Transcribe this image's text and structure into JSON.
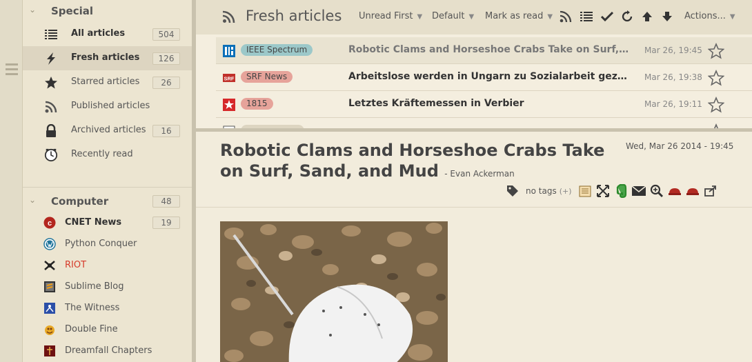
{
  "sidebar": {
    "special": {
      "title": "Special",
      "items": [
        {
          "label": "All articles",
          "count": "504",
          "icon": "list-icon"
        },
        {
          "label": "Fresh articles",
          "count": "126",
          "icon": "lightning-icon"
        },
        {
          "label": "Starred articles",
          "count": "26",
          "icon": "star-icon"
        },
        {
          "label": "Published articles",
          "count": "",
          "icon": "rss-icon"
        },
        {
          "label": "Archived articles",
          "count": "16",
          "icon": "lock-icon"
        },
        {
          "label": "Recently read",
          "count": "",
          "icon": "clock-icon"
        }
      ]
    },
    "computer": {
      "title": "Computer",
      "count": "48",
      "feeds": [
        {
          "label": "CNET News",
          "count": "19",
          "icon": "cnet-icon"
        },
        {
          "label": "Python Conquer",
          "count": "",
          "icon": "wordpress-icon"
        },
        {
          "label": "RIOT",
          "count": "",
          "icon": "riot-icon"
        },
        {
          "label": "Sublime Blog",
          "count": "",
          "icon": "sublime-icon"
        },
        {
          "label": "The Witness",
          "count": "",
          "icon": "witness-icon"
        },
        {
          "label": "Double Fine",
          "count": "",
          "icon": "doublefine-icon"
        },
        {
          "label": "Dreamfall Chapters",
          "count": "",
          "icon": "dreamfall-icon"
        }
      ]
    }
  },
  "toolbar": {
    "feed_title": "Fresh articles",
    "order": "Unread First",
    "view": "Default",
    "mark": "Mark as read",
    "actions": "Actions..."
  },
  "headlines": [
    {
      "tag": "IEEE Spectrum",
      "tag_color": "#9cc8c9",
      "title": "Robotic Clams and Horseshoe Crabs Take on Surf, Sand, and Mud",
      "date": "Mar 26, 19:45"
    },
    {
      "tag": "SRF News",
      "tag_color": "#e6a39a",
      "title": "Arbeitslose werden in Ungarn zu Sozialarbeit gezwungen",
      "date": "Mar 26, 19:38"
    },
    {
      "tag": "1815",
      "tag_color": "#e6a39a",
      "title": "Letztes Kräftemessen in Verbier",
      "date": "Mar 26, 19:11"
    }
  ],
  "article": {
    "title": "Robotic Clams and Horseshoe Crabs Take on Surf, Sand, and Mud",
    "author": "- Evan Ackerman",
    "date": "Wed, Mar 26 2014 - 19:45",
    "tags_label": "no tags",
    "tags_add": "(+)"
  },
  "colors": {
    "accent_red": "#c0392b",
    "bg": "#efe8d6"
  }
}
